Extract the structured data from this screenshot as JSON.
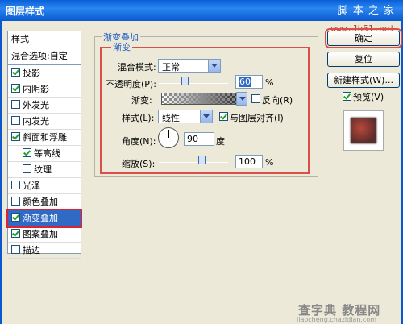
{
  "window": {
    "title": "图层样式",
    "watermark": "脚 本 之 家",
    "url": "www.Jb51.net"
  },
  "sidebar": {
    "header": "样式",
    "blend_options": "混合选项:自定",
    "items": [
      {
        "label": "投影",
        "checked": true
      },
      {
        "label": "内阴影",
        "checked": true
      },
      {
        "label": "外发光",
        "checked": false
      },
      {
        "label": "内发光",
        "checked": false
      },
      {
        "label": "斜面和浮雕",
        "checked": true
      },
      {
        "label": "等高线",
        "checked": true
      },
      {
        "label": "纹理",
        "checked": false
      },
      {
        "label": "光泽",
        "checked": false
      },
      {
        "label": "颜色叠加",
        "checked": false
      },
      {
        "label": "渐变叠加",
        "checked": true
      },
      {
        "label": "图案叠加",
        "checked": true
      },
      {
        "label": "描边",
        "checked": false
      }
    ]
  },
  "panel": {
    "group_title": "渐变叠加",
    "sub_title": "渐变",
    "blend_mode_label": "混合模式:",
    "blend_mode_value": "正常",
    "opacity_label": "不透明度(P):",
    "opacity_value": "60",
    "opacity_unit": "%",
    "opacity_level": 0.6,
    "gradient_label": "渐变:",
    "reverse_label": "反向(R)",
    "reverse_checked": false,
    "style_label": "样式(L):",
    "style_value": "线性",
    "align_label": "与图层对齐(I)",
    "align_checked": true,
    "angle_label": "角度(N):",
    "angle_value": "90",
    "angle_unit": "度",
    "scale_label": "缩放(S):",
    "scale_value": "100",
    "scale_unit": "%",
    "scale_level": 1.0
  },
  "buttons": {
    "ok": "确定",
    "reset": "复位",
    "new_style": "新建样式(W)...",
    "preview_label": "预览(V)",
    "preview_checked": true
  },
  "footer": {
    "watermark": "查字典 教程网",
    "watermark_url": "jiaocheng.chazidian.com"
  }
}
